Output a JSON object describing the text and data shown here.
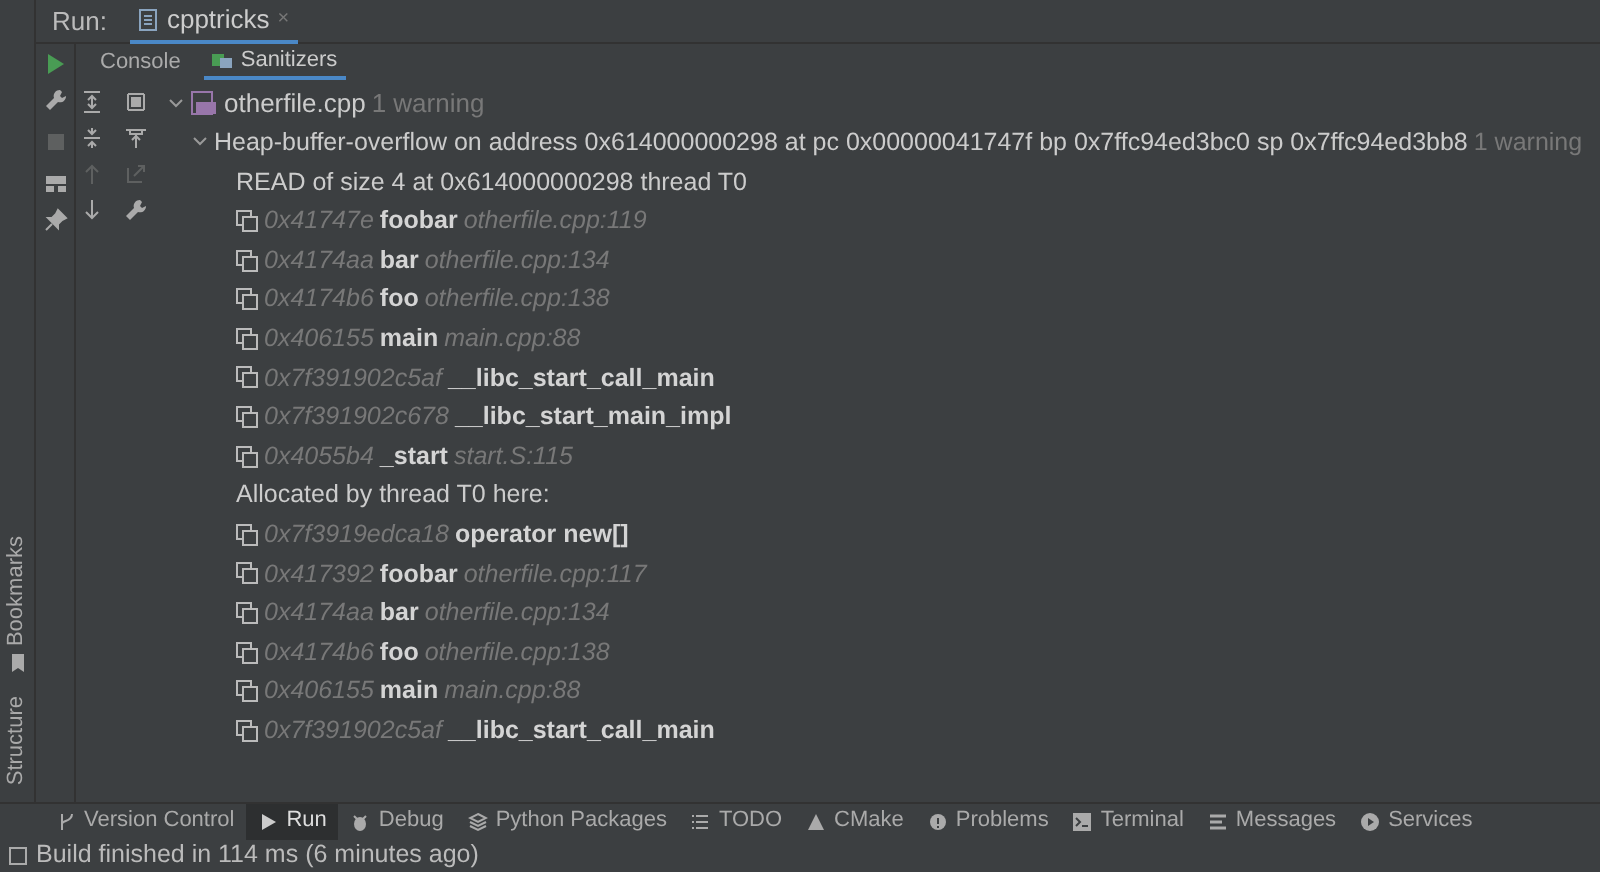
{
  "run_label": "Run:",
  "run_tab": {
    "label": "cpptricks",
    "close": "×"
  },
  "tabs": [
    {
      "label": "Console",
      "selected": false
    },
    {
      "label": "Sanitizers",
      "selected": true
    }
  ],
  "tree": {
    "label": "otherfile.cpp",
    "note": "1 warning",
    "expanded": true,
    "children": [
      {
        "label": "Heap-buffer-overflow on address 0x614000000298 at pc 0x00000041747f bp 0x7ffc94ed3bc0 sp 0x7ffc94ed3bb8",
        "note": "1 warning",
        "expanded": true,
        "children": [
          {
            "kind": "text",
            "label": "READ of size 4 at 0x614000000298 thread T0"
          },
          {
            "kind": "frame",
            "address": "0x41747e",
            "function": "foobar",
            "location": "otherfile.cpp:119"
          },
          {
            "kind": "frame",
            "address": "0x4174aa",
            "function": "bar",
            "location": "otherfile.cpp:134"
          },
          {
            "kind": "frame",
            "address": "0x4174b6",
            "function": "foo",
            "location": "otherfile.cpp:138"
          },
          {
            "kind": "frame",
            "address": "0x406155",
            "function": "main",
            "location": "main.cpp:88"
          },
          {
            "kind": "frame",
            "address": "0x7f391902c5af",
            "function": "__libc_start_call_main"
          },
          {
            "kind": "frame",
            "address": "0x7f391902c678",
            "function": "__libc_start_main_impl"
          },
          {
            "kind": "frame",
            "address": "0x4055b4",
            "function": "_start",
            "location": "start.S:115"
          },
          {
            "kind": "text",
            "label": "Allocated by thread T0 here:"
          },
          {
            "kind": "frame",
            "address": "0x7f3919edca18",
            "function": "operator new[]"
          },
          {
            "kind": "frame",
            "address": "0x417392",
            "function": "foobar",
            "location": "otherfile.cpp:117"
          },
          {
            "kind": "frame",
            "address": "0x4174aa",
            "function": "bar",
            "location": "otherfile.cpp:134"
          },
          {
            "kind": "frame",
            "address": "0x4174b6",
            "function": "foo",
            "location": "otherfile.cpp:138"
          },
          {
            "kind": "frame",
            "address": "0x406155",
            "function": "main",
            "location": "main.cpp:88"
          },
          {
            "kind": "frame",
            "address": "0x7f391902c5af",
            "function": "__libc_start_call_main"
          }
        ]
      }
    ]
  },
  "side_tabs": [
    "Bookmarks",
    "Structure"
  ],
  "tool_windows": [
    {
      "label": "Version Control",
      "kind": "branch",
      "selected": false
    },
    {
      "label": "Run",
      "kind": "play",
      "selected": true
    },
    {
      "label": "Debug",
      "kind": "bug",
      "selected": false
    },
    {
      "label": "Python Packages",
      "kind": "layers",
      "selected": false
    },
    {
      "label": "TODO",
      "kind": "list",
      "selected": false
    },
    {
      "label": "CMake",
      "kind": "triangle",
      "selected": false
    },
    {
      "label": "Problems",
      "kind": "info",
      "selected": false
    },
    {
      "label": "Terminal",
      "kind": "terminal",
      "selected": false
    },
    {
      "label": "Messages",
      "kind": "lines",
      "selected": false
    },
    {
      "label": "Services",
      "kind": "circle",
      "selected": false
    }
  ],
  "status": "Build finished in 114 ms (6 minutes ago)"
}
